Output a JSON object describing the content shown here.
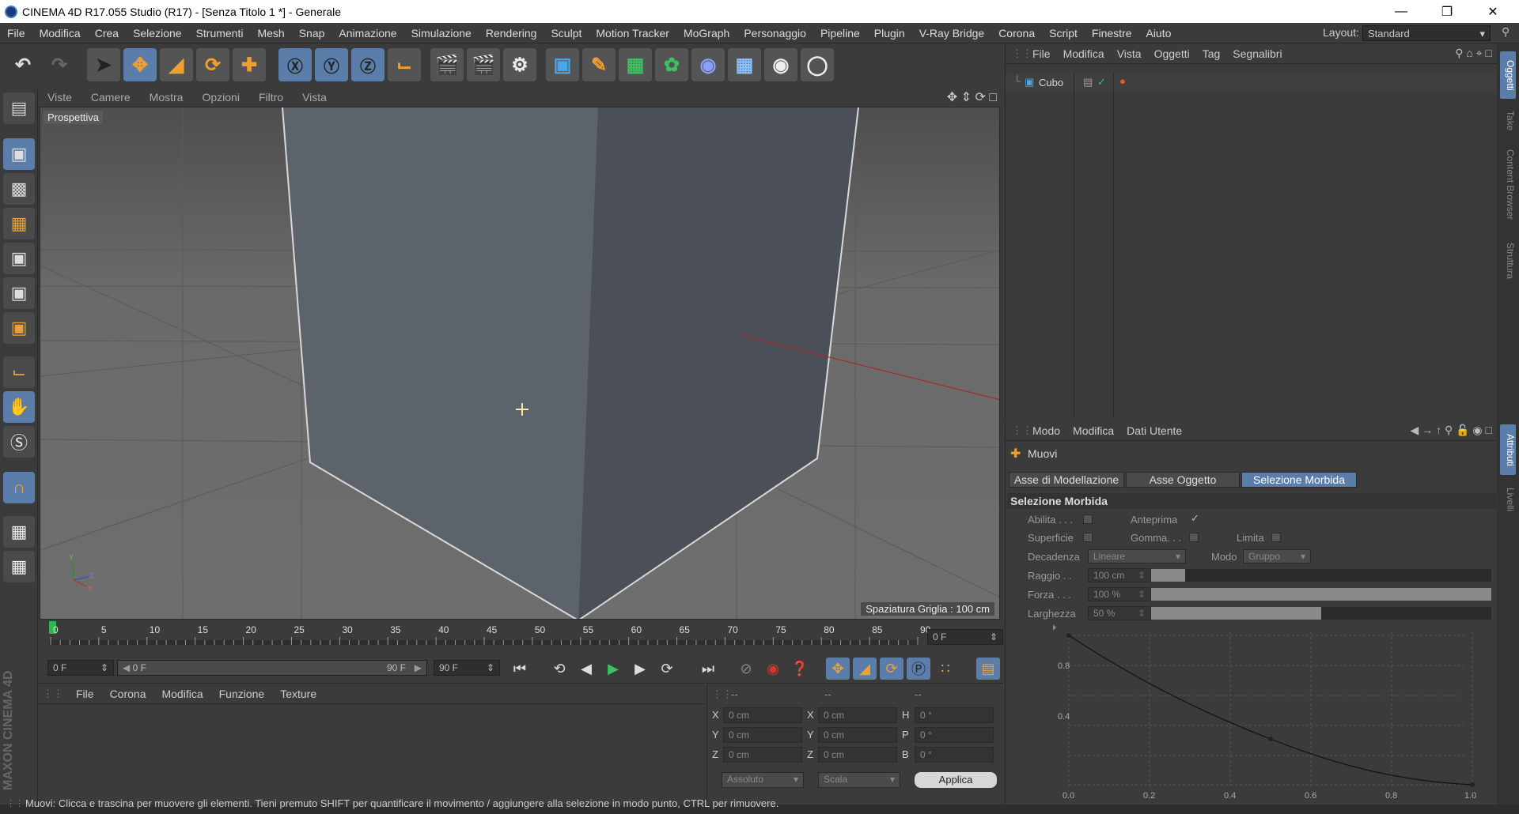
{
  "window": {
    "title": "CINEMA 4D R17.055 Studio (R17) - [Senza Titolo 1 *] - Generale"
  },
  "menu": [
    "File",
    "Modifica",
    "Crea",
    "Selezione",
    "Strumenti",
    "Mesh",
    "Snap",
    "Animazione",
    "Simulazione",
    "Rendering",
    "Sculpt",
    "Motion Tracker",
    "MoGraph",
    "Personaggio",
    "Pipeline",
    "Plugin",
    "V-Ray Bridge",
    "Corona",
    "Script",
    "Finestre",
    "Aiuto"
  ],
  "layout": {
    "label": "Layout:",
    "value": "Standard"
  },
  "viewport": {
    "menu": [
      "Viste",
      "Camere",
      "Mostra",
      "Opzioni",
      "Filtro",
      "Vista"
    ],
    "label": "Prospettiva",
    "grid_label": "Spaziatura Griglia : 100 cm",
    "axis_labels": {
      "y": "Y",
      "z": "Z",
      "x": "X"
    }
  },
  "timeline": {
    "ticks": [
      "0",
      "5",
      "10",
      "15",
      "20",
      "25",
      "30",
      "35",
      "40",
      "45",
      "50",
      "55",
      "60",
      "65",
      "70",
      "75",
      "80",
      "85",
      "90"
    ],
    "current_frame": "0 F",
    "start_field": "0 F",
    "range_start": "0 F",
    "range_end": "90 F",
    "end_field": "90 F"
  },
  "material_panel": {
    "menu": [
      "File",
      "Corona",
      "Modifica",
      "Funzione",
      "Texture"
    ]
  },
  "coord_panel": {
    "headers": [
      "--",
      "--",
      "--"
    ],
    "rows": [
      {
        "l1": "X",
        "v1": "0 cm",
        "l2": "X",
        "v2": "0 cm",
        "l3": "H",
        "v3": "0 °"
      },
      {
        "l1": "Y",
        "v1": "0 cm",
        "l2": "Y",
        "v2": "0 cm",
        "l3": "P",
        "v3": "0 °"
      },
      {
        "l1": "Z",
        "v1": "0 cm",
        "l2": "Z",
        "v2": "0 cm",
        "l3": "B",
        "v3": "0 °"
      }
    ],
    "mode1": "Assoluto",
    "mode2": "Scala",
    "apply": "Applica"
  },
  "object_manager": {
    "menu": [
      "File",
      "Modifica",
      "Vista",
      "Oggetti",
      "Tag",
      "Segnalibri"
    ],
    "objects": [
      {
        "name": "Cubo"
      }
    ]
  },
  "attributes": {
    "menu": [
      "Modo",
      "Modifica",
      "Dati Utente"
    ],
    "tool_name": "Muovi",
    "tabs": [
      "Asse di Modellazione",
      "Asse Oggetto",
      "Selezione Morbida"
    ],
    "section": "Selezione Morbida",
    "abilita": "Abilita . . .",
    "anteprima": "Anteprima",
    "superficie": "Superficie",
    "gomma": "Gomma. . .",
    "limita": "Limita",
    "decadenza_label": "Decadenza",
    "decadenza_value": "Lineare",
    "modo_label": "Modo",
    "modo_value": "Gruppo",
    "raggio_label": "Raggio . .",
    "raggio_value": "100 cm",
    "raggio_fill": 0.1,
    "forza_label": "Forza . . .",
    "forza_value": "100 %",
    "forza_fill": 1.0,
    "larghezza_label": "Larghezza",
    "larghezza_value": "50 %",
    "larghezza_fill": 0.5,
    "curve_x_ticks": [
      "0.0",
      "0.2",
      "0.4",
      "0.6",
      "0.8",
      "1.0"
    ],
    "curve_y_ticks": [
      "0.8",
      "0.4"
    ]
  },
  "side_tabs": [
    "Oggetti",
    "Take",
    "Content Browser",
    "Struttura",
    "Attributi",
    "Livelli"
  ],
  "brand": "MAXON CINEMA 4D",
  "status": "Muovi: Clicca e trascina per muovere gli elementi. Tieni premuto SHIFT per quantificare il movimento / aggiungere alla selezione in modo punto, CTRL per rimuovere."
}
